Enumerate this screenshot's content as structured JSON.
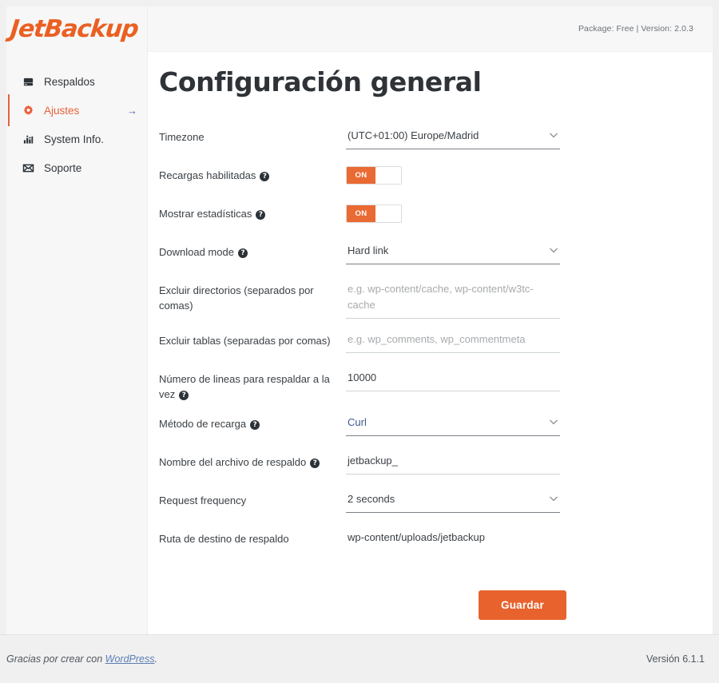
{
  "brand": {
    "name": "JetBackup"
  },
  "topbar": {
    "package_version": "Package: Free | Version: 2.0.3"
  },
  "sidebar": {
    "items": [
      {
        "label": "Respaldos",
        "icon": "hard-drive-icon",
        "active": false
      },
      {
        "label": "Ajustes",
        "icon": "gear-icon",
        "active": true,
        "arrow": "→"
      },
      {
        "label": "System Info.",
        "icon": "bar-chart-icon",
        "active": false
      },
      {
        "label": "Soporte",
        "icon": "envelope-icon",
        "active": false
      }
    ]
  },
  "main": {
    "title": "Configuración general",
    "fields": [
      {
        "label": "Timezone",
        "help": false,
        "type": "select",
        "value": "(UTC+01:00) Europe/Madrid"
      },
      {
        "label": "Recargas habilitadas",
        "help": true,
        "type": "toggle",
        "value": "ON"
      },
      {
        "label": "Mostrar estadísticas",
        "help": true,
        "type": "toggle",
        "value": "ON"
      },
      {
        "label": "Download mode",
        "help": true,
        "type": "select",
        "value": "Hard link"
      },
      {
        "label": "Excluir directorios (separados por comas)",
        "help": false,
        "type": "text",
        "value": "",
        "placeholder": "e.g. wp-content/cache, wp-content/w3tc-cache"
      },
      {
        "label": "Excluir tablas (separadas por comas)",
        "help": false,
        "type": "text",
        "value": "",
        "placeholder": "e.g. wp_comments, wp_commentmeta"
      },
      {
        "label": "Número de lineas para respaldar a la vez",
        "help": true,
        "type": "text",
        "value": "10000",
        "placeholder": ""
      },
      {
        "label": "Método de recarga",
        "help": true,
        "type": "select",
        "value": "Curl",
        "accent": true
      },
      {
        "label": "Nombre del archivo de respaldo",
        "help": true,
        "type": "text",
        "value": "jetbackup_",
        "placeholder": ""
      },
      {
        "label": "Request frequency",
        "help": false,
        "type": "select",
        "value": "2 seconds"
      },
      {
        "label": "Ruta de destino de respaldo",
        "help": false,
        "type": "readonly",
        "value": "wp-content/uploads/jetbackup"
      }
    ],
    "save_label": "Guardar",
    "help_glyph": "?"
  },
  "footer": {
    "credit_prefix": "Gracias por crear con ",
    "credit_link": "WordPress",
    "credit_suffix": ".",
    "version": "Versión 6.1.1"
  },
  "colors": {
    "accent": "#e8622e",
    "logo": "#ea6023",
    "toggle_on": "#ea6a33",
    "link": "#5a7fb5",
    "select_value_accent": "#3f5b8b"
  }
}
